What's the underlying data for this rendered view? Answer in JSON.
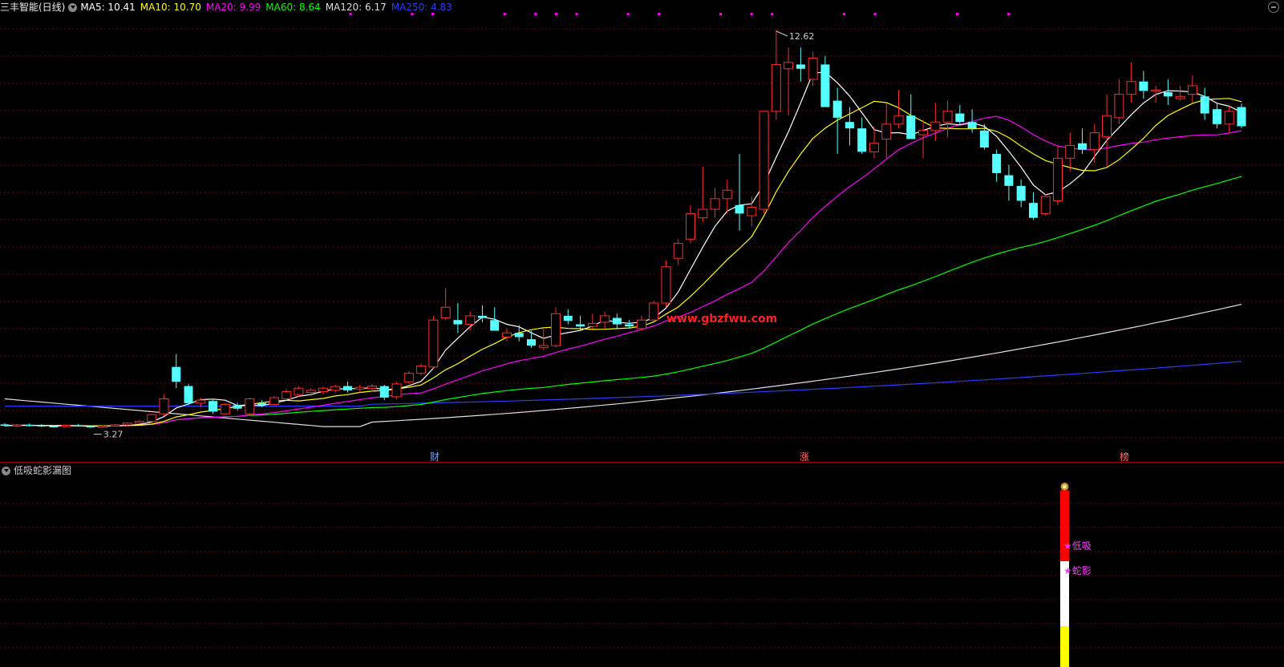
{
  "header": {
    "stock_title": "三丰智能(日线)",
    "ma_items": [
      {
        "label": "MA5: 10.41",
        "color": "#ffffff"
      },
      {
        "label": "MA10: 10.70",
        "color": "#ffff00"
      },
      {
        "label": "MA20: 9.99",
        "color": "#ff00ff"
      },
      {
        "label": "MA60: 8.64",
        "color": "#00ff00"
      },
      {
        "label": "MA120: 6.17",
        "color": "#dddddd"
      },
      {
        "label": "MA250: 4.83",
        "color": "#2a3cff"
      }
    ]
  },
  "indicator": {
    "title": "低吸蛇影漏图",
    "label_low": "★低吸",
    "label_snake": "★蛇影"
  },
  "colors": {
    "up": "#ff2b2b",
    "down": "#54ffff",
    "grid": "#7a0000",
    "divider": "#b00000"
  },
  "chart_data": {
    "type": "candlestick",
    "price_range": [
      3.27,
      12.62
    ],
    "annotations": [
      {
        "text": "12.62",
        "kind": "high"
      },
      {
        "text": "3.27",
        "kind": "low"
      }
    ],
    "watermark": "www.gbzfwu.com",
    "event_markers": [
      "财",
      "涨",
      "榜"
    ],
    "candles": [
      [
        3.35,
        3.38,
        3.3,
        3.32
      ],
      [
        3.32,
        3.36,
        3.28,
        3.34
      ],
      [
        3.34,
        3.37,
        3.3,
        3.33
      ],
      [
        3.33,
        3.36,
        3.29,
        3.31
      ],
      [
        3.31,
        3.34,
        3.28,
        3.3
      ],
      [
        3.3,
        3.35,
        3.28,
        3.33
      ],
      [
        3.33,
        3.36,
        3.3,
        3.31
      ],
      [
        3.31,
        3.33,
        3.27,
        3.29
      ],
      [
        3.29,
        3.33,
        3.27,
        3.31
      ],
      [
        3.31,
        3.36,
        3.3,
        3.34
      ],
      [
        3.34,
        3.4,
        3.32,
        3.38
      ],
      [
        3.38,
        3.45,
        3.35,
        3.42
      ],
      [
        3.42,
        3.6,
        3.4,
        3.58
      ],
      [
        3.6,
        4.05,
        3.55,
        3.95
      ],
      [
        4.7,
        5.0,
        4.2,
        4.35
      ],
      [
        4.25,
        4.3,
        3.8,
        3.85
      ],
      [
        3.85,
        3.98,
        3.75,
        3.92
      ],
      [
        3.9,
        3.95,
        3.6,
        3.65
      ],
      [
        3.6,
        3.85,
        3.58,
        3.82
      ],
      [
        3.8,
        3.86,
        3.68,
        3.72
      ],
      [
        3.6,
        3.98,
        3.55,
        3.95
      ],
      [
        3.85,
        3.92,
        3.76,
        3.8
      ],
      [
        3.82,
        4.02,
        3.8,
        3.98
      ],
      [
        3.95,
        4.18,
        3.92,
        4.12
      ],
      [
        4.05,
        4.25,
        4.0,
        4.2
      ],
      [
        4.1,
        4.2,
        4.02,
        4.15
      ],
      [
        4.12,
        4.25,
        4.05,
        4.2
      ],
      [
        4.15,
        4.28,
        4.1,
        4.24
      ],
      [
        4.25,
        4.35,
        4.1,
        4.15
      ],
      [
        4.18,
        4.28,
        4.1,
        4.22
      ],
      [
        4.2,
        4.3,
        4.12,
        4.25
      ],
      [
        4.25,
        4.28,
        3.92,
        3.98
      ],
      [
        4.0,
        4.35,
        3.95,
        4.3
      ],
      [
        4.35,
        4.6,
        4.3,
        4.55
      ],
      [
        4.55,
        4.78,
        4.5,
        4.72
      ],
      [
        4.7,
        5.9,
        4.65,
        5.8
      ],
      [
        5.85,
        6.55,
        5.8,
        6.1
      ],
      [
        5.8,
        6.2,
        5.5,
        5.7
      ],
      [
        5.7,
        6.0,
        5.55,
        5.9
      ],
      [
        5.9,
        6.15,
        5.75,
        5.85
      ],
      [
        5.8,
        6.1,
        5.55,
        5.55
      ],
      [
        5.4,
        5.6,
        5.3,
        5.5
      ],
      [
        5.5,
        5.68,
        5.3,
        5.4
      ],
      [
        5.35,
        5.55,
        5.15,
        5.2
      ],
      [
        5.15,
        5.6,
        5.1,
        5.2
      ],
      [
        5.2,
        6.1,
        5.15,
        5.95
      ],
      [
        5.9,
        6.05,
        5.7,
        5.78
      ],
      [
        5.7,
        5.9,
        5.55,
        5.65
      ],
      [
        5.65,
        5.95,
        5.6,
        5.72
      ],
      [
        5.75,
        6.0,
        5.6,
        5.9
      ],
      [
        5.85,
        5.95,
        5.6,
        5.7
      ],
      [
        5.7,
        5.8,
        5.6,
        5.65
      ],
      [
        5.6,
        5.9,
        5.55,
        5.8
      ],
      [
        5.8,
        6.25,
        5.78,
        6.2
      ],
      [
        6.2,
        7.2,
        6.1,
        7.05
      ],
      [
        7.25,
        7.7,
        7.1,
        7.6
      ],
      [
        7.7,
        8.5,
        7.6,
        8.3
      ],
      [
        8.2,
        9.4,
        8.1,
        8.4
      ],
      [
        8.4,
        8.9,
        8.2,
        8.65
      ],
      [
        8.65,
        9.1,
        8.3,
        8.85
      ],
      [
        8.5,
        9.7,
        7.9,
        8.3
      ],
      [
        8.25,
        8.7,
        8.0,
        8.45
      ],
      [
        8.4,
        10.7,
        8.3,
        10.7
      ],
      [
        10.7,
        12.62,
        10.5,
        11.8
      ],
      [
        11.7,
        12.2,
        10.6,
        11.85
      ],
      [
        11.8,
        12.2,
        11.4,
        11.7
      ],
      [
        11.45,
        12.1,
        11.3,
        11.95
      ],
      [
        11.8,
        12.0,
        11.0,
        10.8
      ],
      [
        10.95,
        11.25,
        9.7,
        10.55
      ],
      [
        10.45,
        10.8,
        9.9,
        10.3
      ],
      [
        10.3,
        10.55,
        9.7,
        9.75
      ],
      [
        9.75,
        10.35,
        9.6,
        9.95
      ],
      [
        10.05,
        10.9,
        9.6,
        10.4
      ],
      [
        10.4,
        11.2,
        10.3,
        10.6
      ],
      [
        10.6,
        11.1,
        10.15,
        10.05
      ],
      [
        10.15,
        10.5,
        9.6,
        10.25
      ],
      [
        10.25,
        10.9,
        10.0,
        10.45
      ],
      [
        10.45,
        10.95,
        10.1,
        10.7
      ],
      [
        10.65,
        10.85,
        10.4,
        10.45
      ],
      [
        10.45,
        10.75,
        10.2,
        10.3
      ],
      [
        10.25,
        10.4,
        9.8,
        9.85
      ],
      [
        9.7,
        9.8,
        9.05,
        9.25
      ],
      [
        9.2,
        9.45,
        8.6,
        8.95
      ],
      [
        8.95,
        9.1,
        8.45,
        8.6
      ],
      [
        8.55,
        8.8,
        8.15,
        8.2
      ],
      [
        8.3,
        8.75,
        8.25,
        8.7
      ],
      [
        8.6,
        9.9,
        8.5,
        9.6
      ],
      [
        9.6,
        10.2,
        9.3,
        9.9
      ],
      [
        9.95,
        10.3,
        9.7,
        9.8
      ],
      [
        9.8,
        10.4,
        9.5,
        10.2
      ],
      [
        10.1,
        11.1,
        9.4,
        10.6
      ],
      [
        10.55,
        11.45,
        10.4,
        11.1
      ],
      [
        11.1,
        11.85,
        10.9,
        11.4
      ],
      [
        11.4,
        11.65,
        11.0,
        11.18
      ],
      [
        11.2,
        11.3,
        10.9,
        11.2
      ],
      [
        11.15,
        11.45,
        10.85,
        11.05
      ],
      [
        11.0,
        11.3,
        10.95,
        11.05
      ],
      [
        11.1,
        11.55,
        10.9,
        11.3
      ],
      [
        11.05,
        11.25,
        10.5,
        10.65
      ],
      [
        10.75,
        10.9,
        10.3,
        10.4
      ],
      [
        10.4,
        10.85,
        10.2,
        10.7
      ],
      [
        10.8,
        10.88,
        10.3,
        10.35
      ]
    ],
    "indicator_bar": [
      {
        "segment": "red",
        "from": 0.0,
        "to": 0.4
      },
      {
        "segment": "white",
        "from": 0.4,
        "to": 0.77
      },
      {
        "segment": "yellow",
        "from": 0.77,
        "to": 1.0
      }
    ]
  }
}
